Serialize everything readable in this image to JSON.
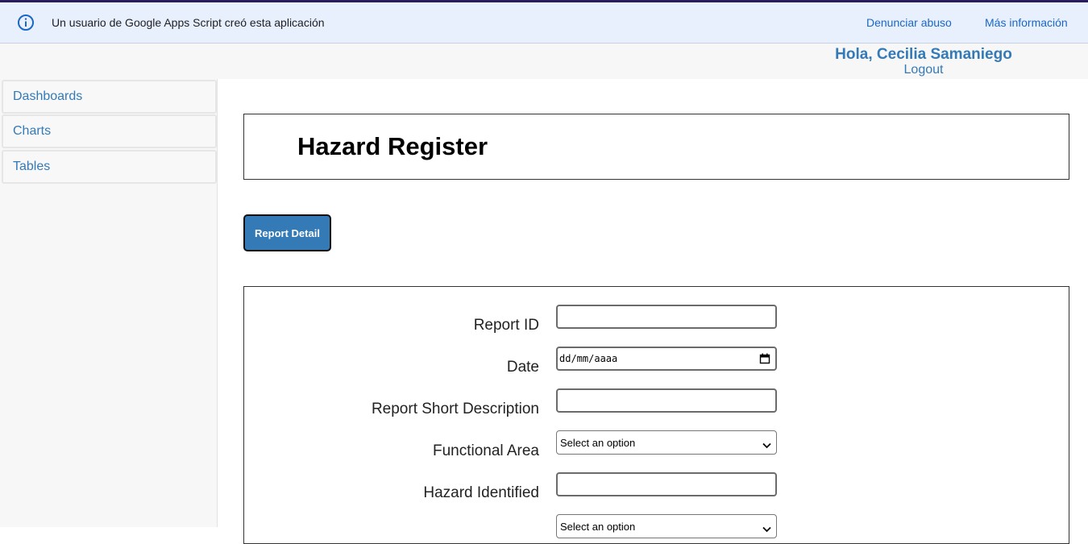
{
  "banner": {
    "message": "Un usuario de Google Apps Script creó esta aplicación",
    "report_abuse": "Denunciar abuso",
    "more_info": "Más información",
    "icon": "info-icon"
  },
  "user": {
    "greeting": "Hola, Cecilia Samaniego",
    "logout": "Logout"
  },
  "sidebar": {
    "items": [
      {
        "label": "Dashboards"
      },
      {
        "label": "Charts"
      },
      {
        "label": "Tables"
      }
    ]
  },
  "page": {
    "title": "Hazard Register",
    "report_button": "Report Detail"
  },
  "form": {
    "fields": [
      {
        "label": "Report ID",
        "value": ""
      },
      {
        "label": "Date",
        "placeholder": "dd/mm/aaaa"
      },
      {
        "label": "Report Short Description",
        "value": ""
      },
      {
        "label": "Functional Area",
        "selected": "Select an option"
      },
      {
        "label": "Hazard Identified",
        "value": ""
      },
      {
        "label": "",
        "selected": "Select an option"
      }
    ]
  },
  "colors": {
    "accent": "#337ab7",
    "banner_bg": "#e8f0fe",
    "banner_link": "#1a67c5",
    "top_accent": "#2b1b5c"
  }
}
